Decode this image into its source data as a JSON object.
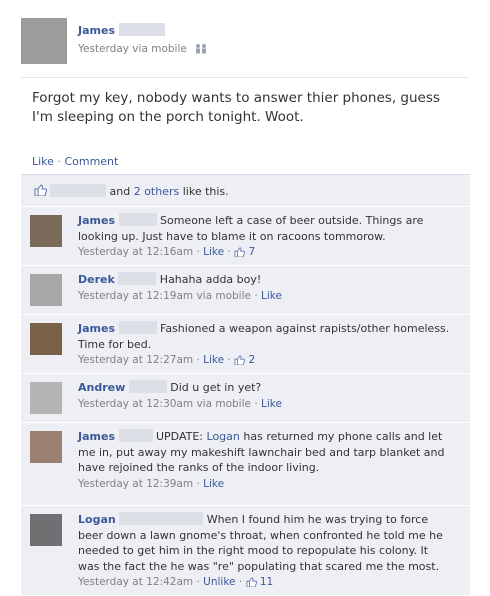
{
  "post": {
    "author": "James",
    "timestamp": "Yesterday via mobile",
    "status": "Forgot my key, nobody wants to answer thier phones, guess I'm sleeping on the porch tonight. Woot."
  },
  "actions": {
    "like": "Like",
    "separator": "·",
    "comment": "Comment"
  },
  "likes": {
    "and": "and",
    "others_link": "2 others",
    "suffix": "like this."
  },
  "comments": [
    {
      "name": "James",
      "text": "Someone left a case of beer outside. Things are looking up. Just have to blame it on racoons tommorow.",
      "time": "Yesterday at 12:16am",
      "like": "Like",
      "likes": "7"
    },
    {
      "name": "Derek",
      "text": "Hahaha adda boy!",
      "time": "Yesterday at 12:19am via mobile",
      "like": "Like"
    },
    {
      "name": "James",
      "text": "Fashioned a weapon against rapists/other homeless. Time for bed.",
      "time": "Yesterday at 12:27am",
      "like": "Like",
      "likes": "2"
    },
    {
      "name": "Andrew",
      "text": "Did u get in yet?",
      "time": "Yesterday at 12:30am via mobile",
      "like": "Like"
    },
    {
      "name": "James",
      "text_prefix": "UPDATE:",
      "mention": "Logan",
      "text": "has returned my phone calls and let me in, put away my makeshift lawnchair bed and tarp blanket and have rejoined the ranks of the indoor living.",
      "time": "Yesterday at 12:39am",
      "like": "Like"
    },
    {
      "name": "Logan",
      "text": "When I found him he was trying to force beer down a lawn gnome's throat, when confronted he told me he needed to get him in the right mood to repopulate his colony. It was the fact the he was \"re\" populating that scared me the most.",
      "time": "Yesterday at 12:42am",
      "unlike": "Unlike",
      "likes": "11"
    }
  ],
  "colors": {
    "link": "#3b5998",
    "panel": "#edeff4",
    "meta": "#808080"
  },
  "icons": {
    "mobile": "mobile-icon",
    "like": "thumbs-up-icon"
  }
}
